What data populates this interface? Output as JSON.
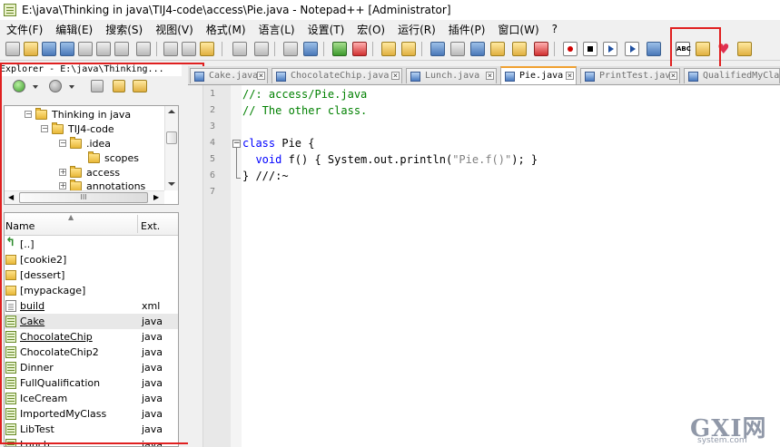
{
  "window": {
    "title": "E:\\java\\Thinking in java\\TIJ4-code\\access\\Pie.java - Notepad++ [Administrator]"
  },
  "menu": [
    "文件(F)",
    "编辑(E)",
    "搜索(S)",
    "视图(V)",
    "格式(M)",
    "语言(L)",
    "设置(T)",
    "宏(O)",
    "运行(R)",
    "插件(P)",
    "窗口(W)",
    "?"
  ],
  "toolbar": {
    "spellcheck_label": "ABC"
  },
  "explorer": {
    "title": "Explorer - E:\\java\\Thinking...",
    "tree": [
      {
        "label": "Thinking in java",
        "expander": "−"
      },
      {
        "label": "TIJ4-code",
        "expander": "−"
      },
      {
        "label": ".idea",
        "expander": "−"
      },
      {
        "label": "scopes",
        "expander": ""
      },
      {
        "label": "access",
        "expander": "+"
      },
      {
        "label": "annotations",
        "expander": "+"
      }
    ],
    "hscroll_grip": "III",
    "columns": {
      "name": "Name",
      "ext": "Ext."
    },
    "files": [
      {
        "name": "[..]",
        "ext": "",
        "icon": "up"
      },
      {
        "name": "[cookie2]",
        "ext": "",
        "icon": "folder"
      },
      {
        "name": "[dessert]",
        "ext": "",
        "icon": "folder"
      },
      {
        "name": "[mypackage]",
        "ext": "",
        "icon": "folder"
      },
      {
        "name": "build",
        "ext": "xml",
        "icon": "doc"
      },
      {
        "name": "Cake",
        "ext": "java",
        "icon": "java"
      },
      {
        "name": "ChocolateChip",
        "ext": "java",
        "icon": "java"
      },
      {
        "name": "ChocolateChip2",
        "ext": "java",
        "icon": "java"
      },
      {
        "name": "Dinner",
        "ext": "java",
        "icon": "java"
      },
      {
        "name": "FullQualification",
        "ext": "java",
        "icon": "java"
      },
      {
        "name": "IceCream",
        "ext": "java",
        "icon": "java"
      },
      {
        "name": "ImportedMyClass",
        "ext": "java",
        "icon": "java"
      },
      {
        "name": "LibTest",
        "ext": "java",
        "icon": "java"
      },
      {
        "name": "Lunch",
        "ext": "java",
        "icon": "java"
      }
    ]
  },
  "tabs": [
    {
      "label": "Cake.java",
      "active": false
    },
    {
      "label": "ChocolateChip.java",
      "active": false
    },
    {
      "label": "Lunch.java",
      "active": false
    },
    {
      "label": "Pie.java",
      "active": true
    },
    {
      "label": "PrintTest.java",
      "active": false
    },
    {
      "label": "QualifiedMyClass",
      "active": false
    }
  ],
  "editor": {
    "line_numbers": [
      "1",
      "2",
      "3",
      "4",
      "5",
      "6",
      "7"
    ],
    "lines": {
      "l1": "//: access/Pie.java",
      "l2": "// The other class.",
      "l4_kw": "class",
      "l4_rest": " Pie {",
      "l5_indent": "  ",
      "l5_kw": "void",
      "l5_mid": " f() { System.out.println(",
      "l5_str": "\"Pie.f()\"",
      "l5_end": "); }",
      "l6": "} ///:~"
    }
  },
  "watermark": {
    "main": "GXI网",
    "sub": "system.com"
  },
  "colors": {
    "highlight": "#e02020",
    "comment": "#008000",
    "keyword": "#0000ff",
    "active_tab_accent": "#f0a030"
  }
}
